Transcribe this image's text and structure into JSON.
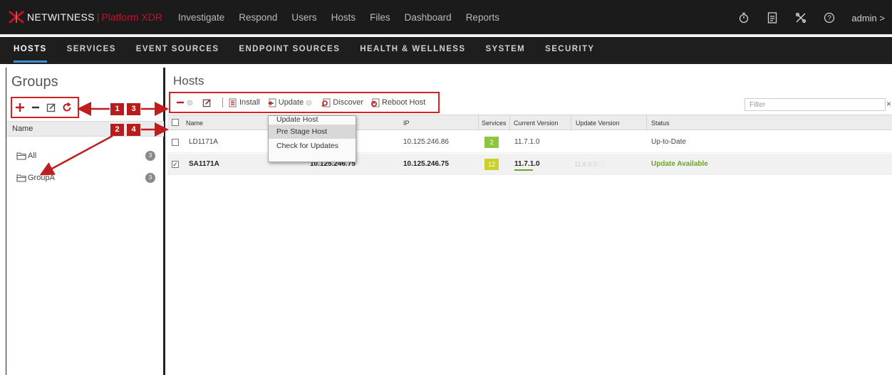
{
  "brand": {
    "name": "NETWITNESS",
    "separator": "|",
    "platform": "Platform XDR"
  },
  "top_nav": [
    "Investigate",
    "Respond",
    "Users",
    "Hosts",
    "Files",
    "Dashboard",
    "Reports"
  ],
  "top_right": {
    "user": "admin >",
    "icons": [
      "stopwatch-icon",
      "report-icon",
      "tools-icon",
      "help-icon"
    ]
  },
  "sub_nav": [
    "HOSTS",
    "SERVICES",
    "EVENT SOURCES",
    "ENDPOINT SOURCES",
    "HEALTH & WELLNESS",
    "SYSTEM",
    "SECURITY"
  ],
  "groups": {
    "title": "Groups",
    "column_header": "Name",
    "items": [
      {
        "label": "All",
        "count": "3"
      },
      {
        "label": "GroupA",
        "count": "3"
      }
    ]
  },
  "callouts": [
    "1",
    "2",
    "3",
    "4"
  ],
  "hosts": {
    "title": "Hosts",
    "toolbar": {
      "install": "Install",
      "update": "Update",
      "discover": "Discover",
      "reboot": "Reboot Host"
    },
    "filter_placeholder": "Filter",
    "filter_close": "×",
    "columns": [
      "Name",
      "IP",
      "Services",
      "Current Version",
      "Update Version",
      "Status"
    ],
    "rows": [
      {
        "checked": false,
        "name": "LD1171A",
        "host": "",
        "ip": "10.125.246.86",
        "services": "2",
        "services_color": "#8cc63f",
        "current_version": "11.7.1.0",
        "update_version": "",
        "status": "Up-to-Date"
      },
      {
        "checked": true,
        "name": "SA1171A",
        "host": "10.125.246.75",
        "ip": "10.125.246.75",
        "services": "12",
        "services_color": "#c8d22a",
        "current_version": "11.7.1.0",
        "update_version": "11.8.0.0",
        "status": "Update Available"
      }
    ]
  },
  "update_menu": [
    "Update Host",
    "Pre Stage Host",
    "Check for Updates"
  ],
  "colors": {
    "accent": "#3d8fd1",
    "brand_red": "#c8102e",
    "callout_red": "#b81d1d",
    "status_green": "#6aa52a"
  }
}
